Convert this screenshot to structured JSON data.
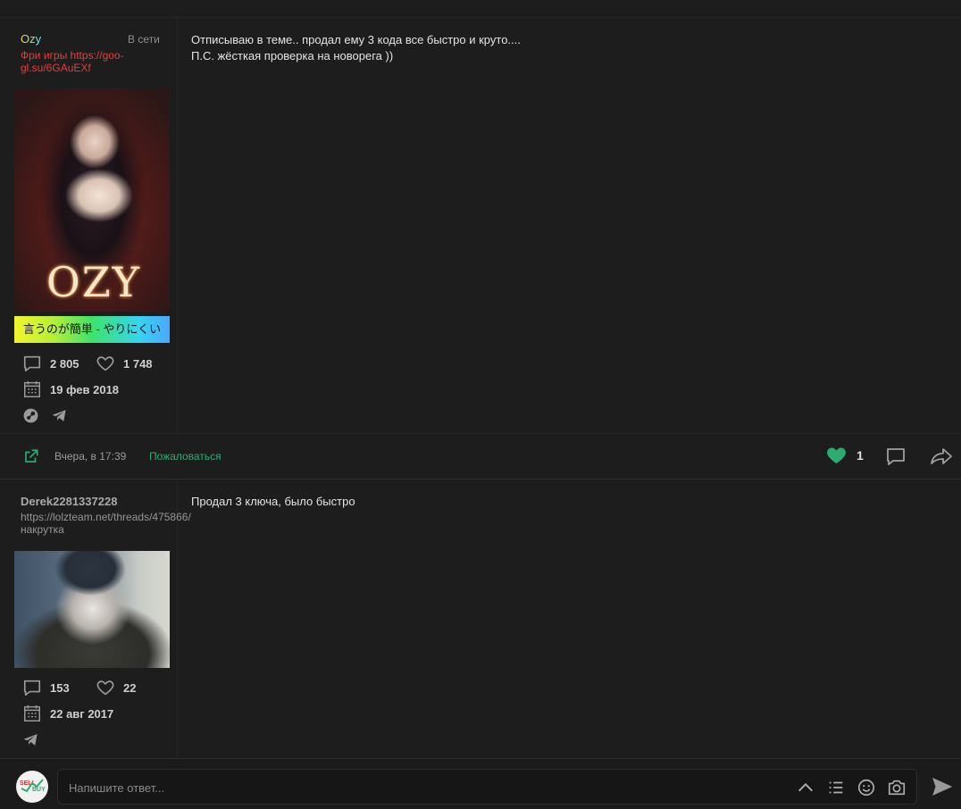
{
  "colors": {
    "accent": "#2bad72",
    "background": "#1d1d1d",
    "status_red": "#e53d3d"
  },
  "posts": [
    {
      "username": "Ozy",
      "online_status": "В сети",
      "user_status": "Фри игры https://goo-gl.su/6GAuEXf",
      "avatar_text": "OZY",
      "tagline": "言うのが簡単 - やりにくい",
      "messages_count": "2 805",
      "likes_count": "1 748",
      "registered": "19 фев 2018",
      "message_lines": [
        "Отписываю в теме.. продал ему 3 кода все быстро и круто....",
        "П.С. жёсткая проверка на новорега ))"
      ],
      "footer": {
        "time": "Вчера, в 17:39",
        "report": "Пожаловаться",
        "likes": "1"
      }
    },
    {
      "username": "Derek2281337228",
      "user_status": "https://lolzteam.net/threads/475866/ накрутка",
      "messages_count": "153",
      "likes_count": "22",
      "registered": "22 авг 2017",
      "message_lines": [
        "Продал 3 ключа, было быстро"
      ]
    }
  ],
  "composer": {
    "placeholder": "Напишите ответ...",
    "logo_top": "SELL",
    "logo_bottom": "BUY"
  },
  "icons": [
    "comment-icon",
    "heart-icon",
    "calendar-icon",
    "steam-icon",
    "telegram-icon",
    "share-icon",
    "reply-icon",
    "forward-icon",
    "chevron-up-icon",
    "list-icon",
    "emoji-icon",
    "camera-icon",
    "send-icon"
  ]
}
